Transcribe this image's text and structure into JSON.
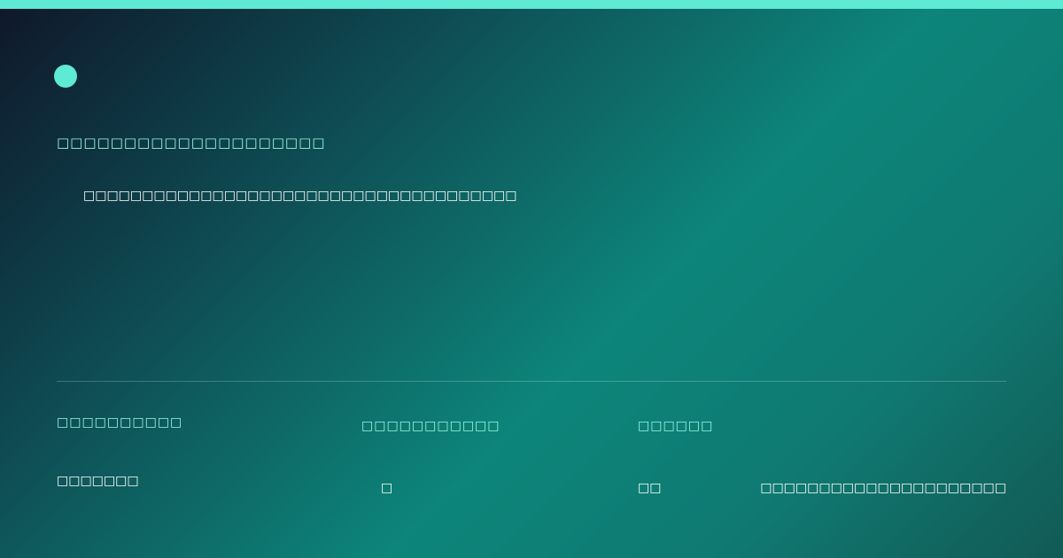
{
  "colors": {
    "accent": "#5eead4",
    "label_text": "#99f6e4",
    "body_text": "#ffffff",
    "background_start": "#0f172a",
    "background_mid": "#0d857a",
    "background_end": "#125a55"
  },
  "header": {
    "logo_icon": "circle-dot",
    "headline": "□□□□□□□□□□□□□□□□□□□□",
    "subline": "□□□□□□□□□□□□□□□□□□□□□□□□□□□□□□□□□□□□□"
  },
  "stats": [
    {
      "label": "□□□□□□□□□□",
      "value": "□□□□□□□"
    },
    {
      "label": "□□□□□□□□□□□",
      "value": "□"
    },
    {
      "label": "□□□□□□",
      "value": "□□"
    }
  ],
  "footer_note": "□□□□□□□□□□□□□□□□□□□□□"
}
